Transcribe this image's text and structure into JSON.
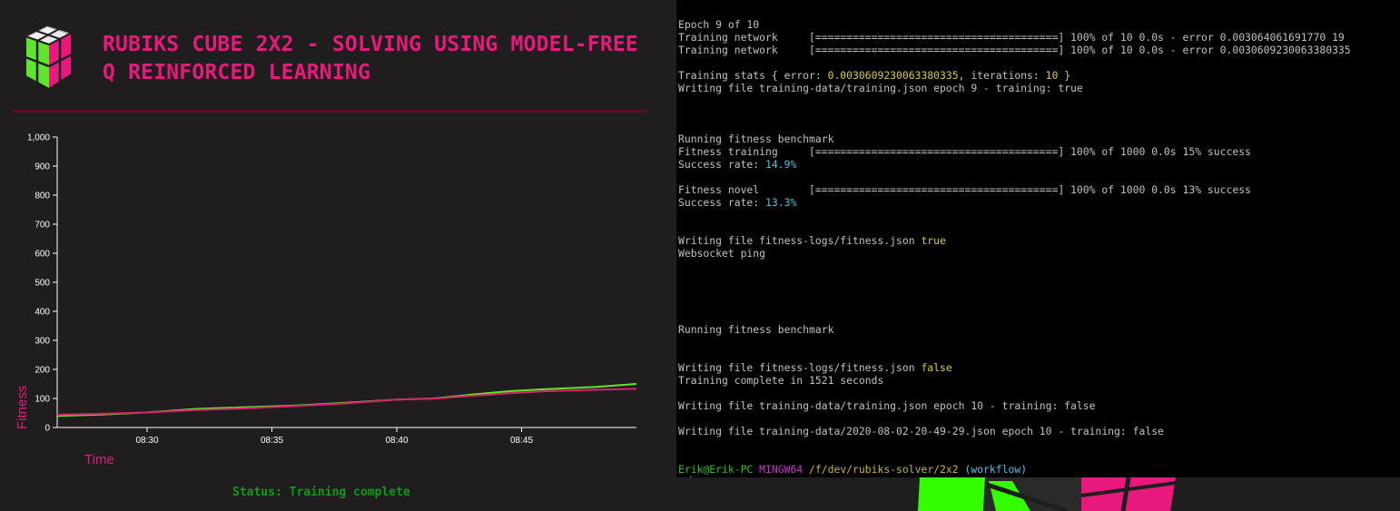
{
  "app": {
    "title": "RUBIKS CUBE 2X2 - SOLVING USING MODEL-FREE Q REINFORCED LEARNING",
    "status": "Status: Training complete"
  },
  "colors": {
    "accent": "#e8197c",
    "green": "#5fe52b",
    "magenta_series": "#d6226a",
    "status_green": "#0f9a1a",
    "terminal_bg": "#000000"
  },
  "chart_data": {
    "type": "line",
    "xlabel": "Time",
    "ylabel": "Fitness",
    "ylim": [
      0,
      1000
    ],
    "y_ticks": [
      "0",
      "100",
      "200",
      "300",
      "400",
      "500",
      "600",
      "700",
      "800",
      "900",
      "1,000"
    ],
    "x_ticks": [
      "08:30",
      "08:35",
      "08:40",
      "08:45"
    ],
    "x_tick_minutes": [
      30,
      35,
      40,
      45
    ],
    "x_range_minutes": [
      26.4,
      49.6
    ],
    "series": [
      {
        "color": "#5fe52b",
        "x_minutes": [
          26.4,
          28,
          30,
          32,
          34,
          36,
          38,
          40,
          41.5,
          43,
          44.5,
          46,
          48,
          49.6
        ],
        "values": [
          40,
          44,
          52,
          64,
          70,
          76,
          85,
          96,
          100,
          113,
          125,
          132,
          140,
          150
        ]
      },
      {
        "color": "#d6226a",
        "x_minutes": [
          26.4,
          28,
          30,
          32,
          34,
          36,
          38,
          40,
          41.5,
          43,
          44.5,
          46,
          48,
          49.6
        ],
        "values": [
          44,
          47,
          52,
          60,
          66,
          74,
          83,
          96,
          99,
          109,
          118,
          125,
          130,
          133
        ]
      }
    ]
  },
  "terminal": {
    "lines": [
      [
        {
          "t": "Epoch 9 of 10"
        }
      ],
      [
        {
          "t": "Training network     [=======================================] 100% of 10 0.0s - error 0.003064061691770 19"
        }
      ],
      [
        {
          "t": "Training network     [=======================================] 100% of 10 0.0s - error 0.0030609230063380335"
        }
      ],
      [],
      [
        {
          "t": "Training stats { error: "
        },
        {
          "t": "0.0030609230063380335",
          "c": "c-yellow"
        },
        {
          "t": ", iterations: "
        },
        {
          "t": "10",
          "c": "c-yellow"
        },
        {
          "t": " }"
        }
      ],
      [
        {
          "t": "Writing file training-data/training.json epoch 9 - training: true"
        }
      ],
      [],
      [],
      [],
      [
        {
          "t": "Running fitness benchmark"
        }
      ],
      [
        {
          "t": "Fitness training     [=======================================] 100% of 1000 0.0s 15% success"
        }
      ],
      [
        {
          "t": "Success rate: "
        },
        {
          "t": "14.9%",
          "c": "c-cyan"
        }
      ],
      [],
      [
        {
          "t": "Fitness novel        [=======================================] 100% of 1000 0.0s 13% success"
        }
      ],
      [
        {
          "t": "Success rate: "
        },
        {
          "t": "13.3%",
          "c": "c-cyan"
        }
      ],
      [],
      [],
      [
        {
          "t": "Writing file fitness-logs/fitness.json "
        },
        {
          "t": "true",
          "c": "c-yellow"
        }
      ],
      [
        {
          "t": "Websocket ping"
        }
      ],
      [],
      [],
      [],
      [],
      [],
      [
        {
          "t": "Running fitness benchmark"
        }
      ],
      [],
      [],
      [
        {
          "t": "Writing file fitness-logs/fitness.json "
        },
        {
          "t": "false",
          "c": "c-yellow"
        }
      ],
      [
        {
          "t": "Training complete in 1521 seconds"
        }
      ],
      [],
      [
        {
          "t": "Writing file training-data/training.json epoch 10 - training: false"
        }
      ],
      [],
      [
        {
          "t": "Writing file training-data/2020-08-02-20-49-29.json epoch 10 - training: false"
        }
      ],
      [],
      [],
      [
        {
          "t": "Erik@Erik-PC",
          "c": "c-green"
        },
        {
          "t": " "
        },
        {
          "t": "MINGW64",
          "c": "c-magenta"
        },
        {
          "t": " "
        },
        {
          "t": "/f/dev/rubiks-solver/2x2",
          "c": "c-yel2"
        },
        {
          "t": " "
        },
        {
          "t": "(workflow)",
          "c": "c-cyan"
        }
      ],
      [
        {
          "t": "$",
          "cursor": true
        }
      ]
    ]
  }
}
